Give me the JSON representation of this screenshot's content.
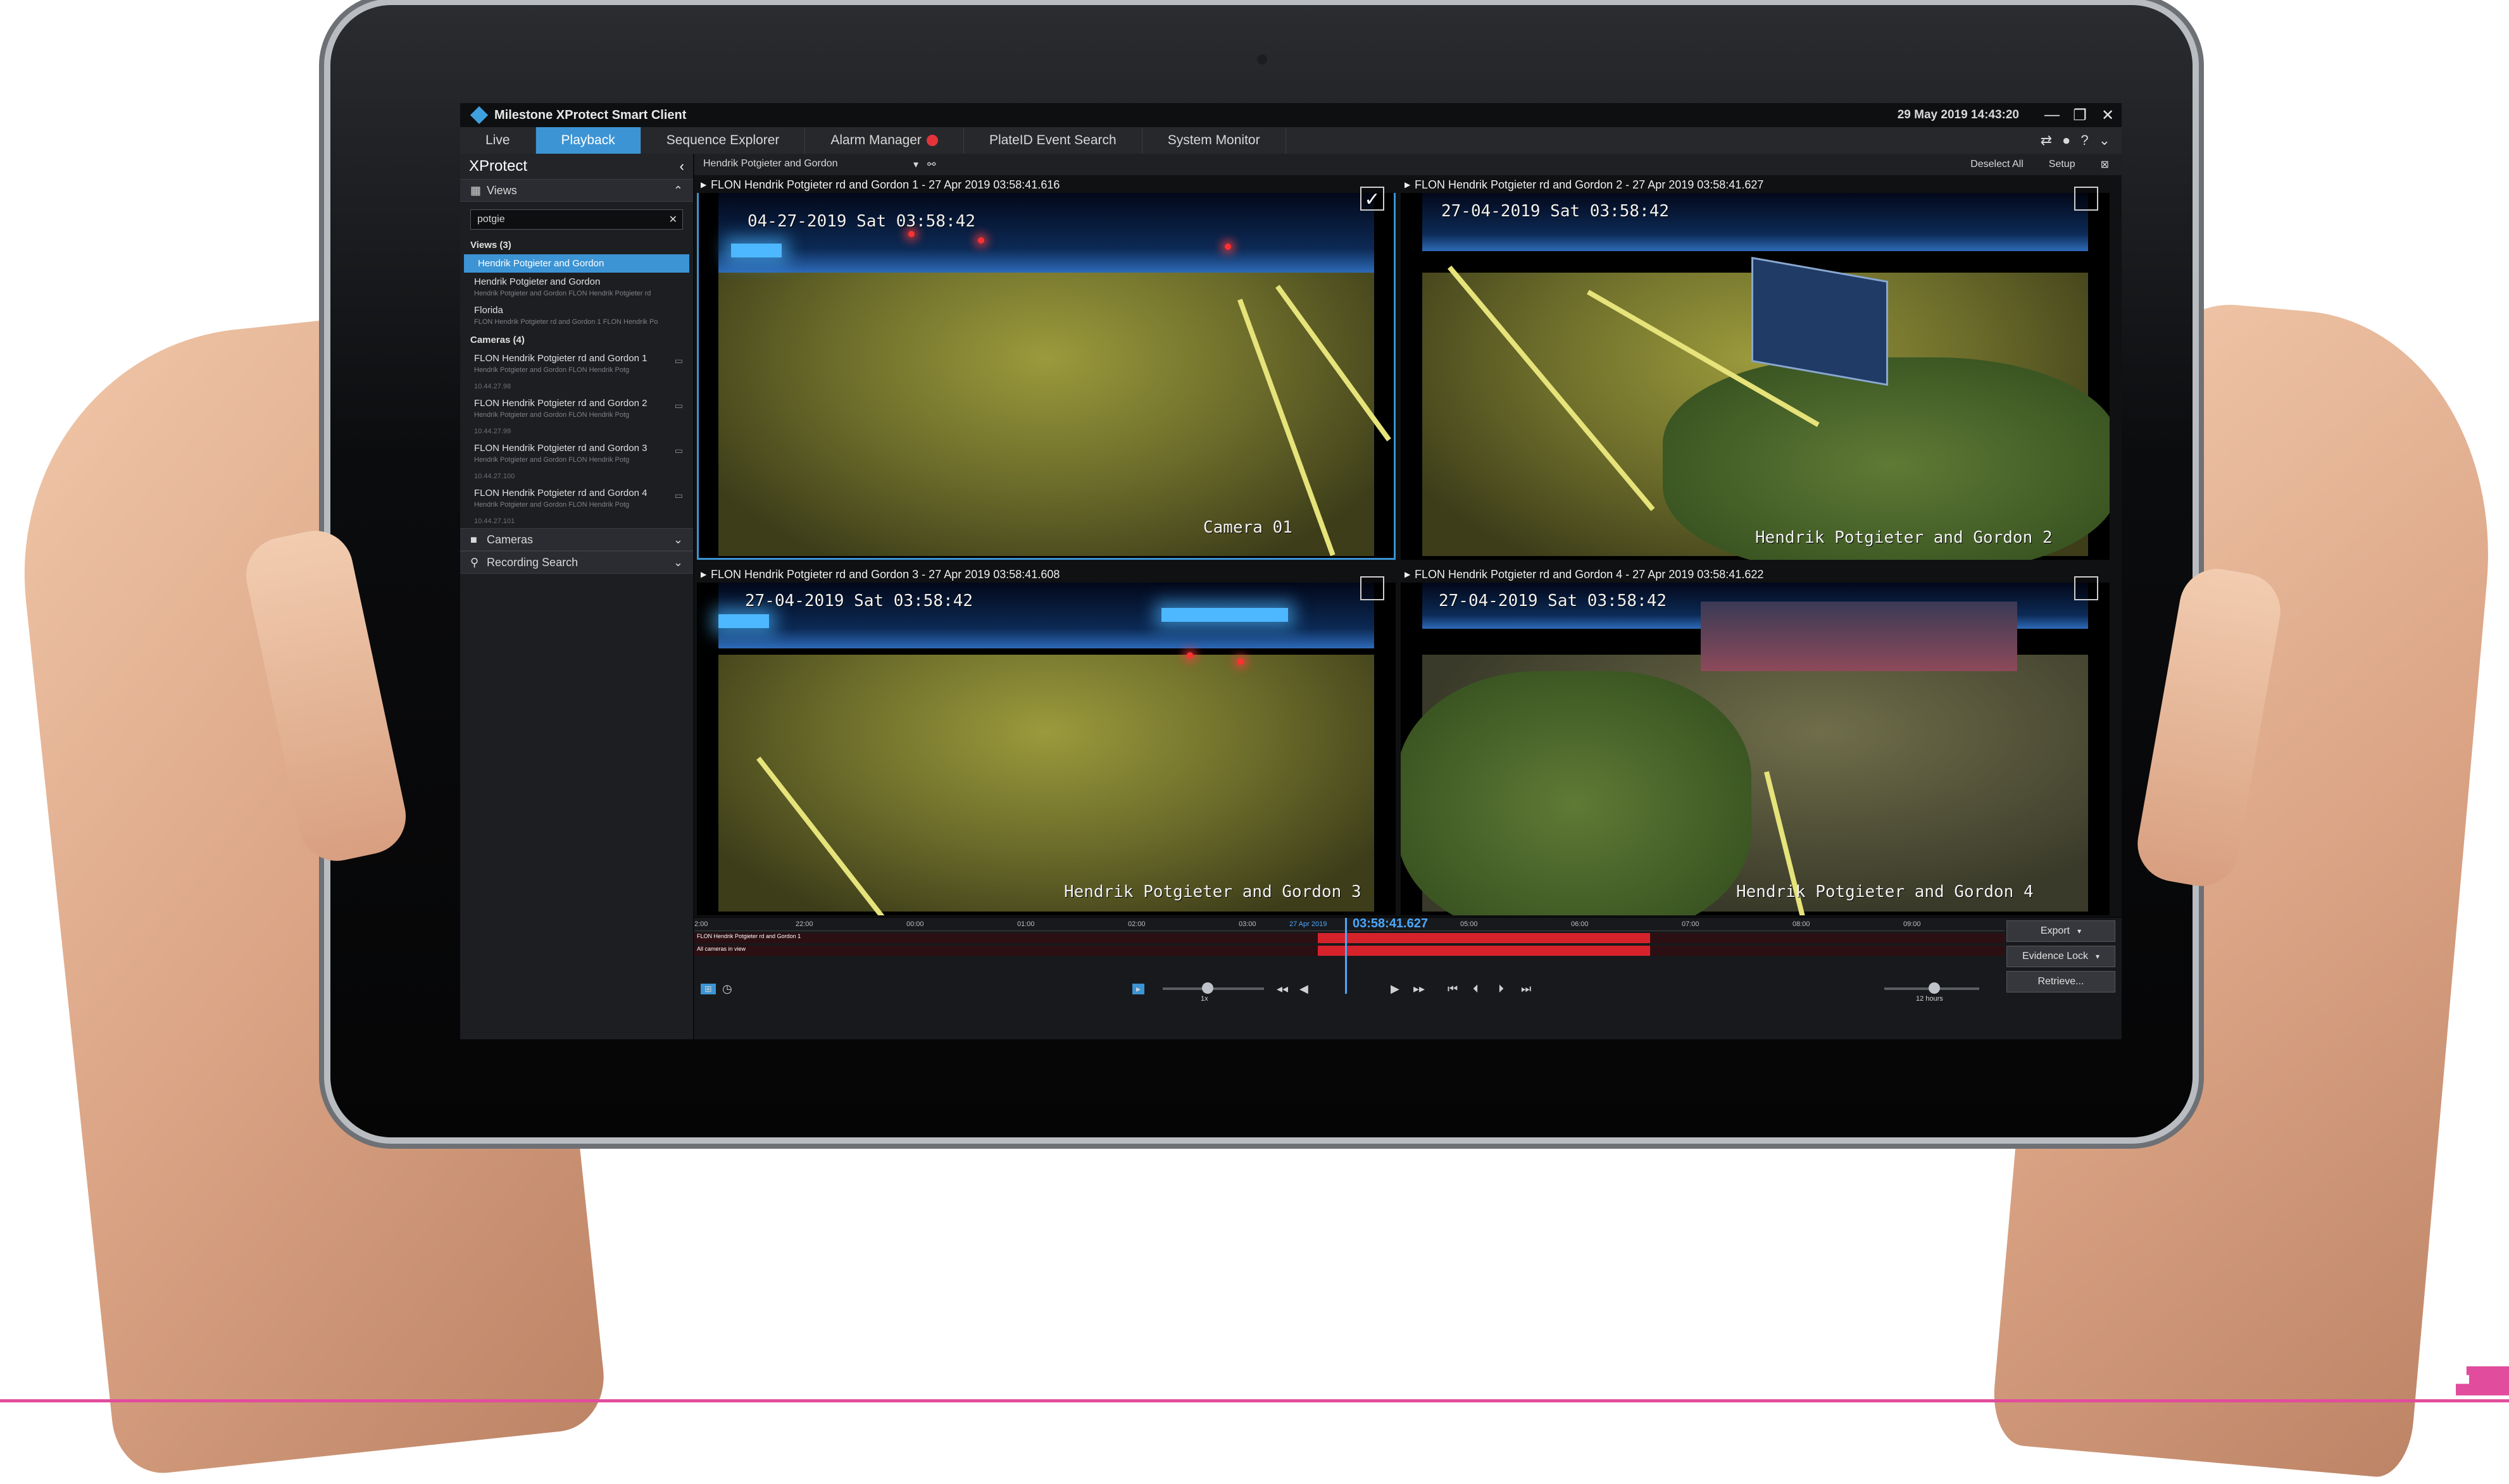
{
  "window": {
    "title": "Milestone XProtect Smart Client",
    "clock": "29 May 2019 14:43:20",
    "minimize": "—",
    "restore": "❐",
    "close": "✕"
  },
  "tabs": [
    {
      "label": "Live"
    },
    {
      "label": "Playback"
    },
    {
      "label": "Sequence Explorer"
    },
    {
      "label": "Alarm Manager"
    },
    {
      "label": "PlateID Event Search"
    },
    {
      "label": "System Monitor"
    }
  ],
  "sidebar": {
    "header": "XProtect",
    "views_pane": "Views",
    "search_value": "potgie",
    "views_section": "Views (3)",
    "views": [
      {
        "label": "Hendrik Potgieter and Gordon",
        "sub": ""
      },
      {
        "label": "Hendrik Potgieter and Gordon",
        "sub": "Hendrik Potgieter and Gordon FLON Hendrik Potgieter rd"
      },
      {
        "label": "Florida",
        "sub": "FLON Hendrik Potgieter rd and Gordon 1 FLON Hendrik Po"
      }
    ],
    "cameras_section": "Cameras (4)",
    "cameras": [
      {
        "label": "FLON Hendrik Potgieter rd and Gordon 1",
        "sub": "Hendrik Potgieter and Gordon FLON Hendrik Potg",
        "ip": "10.44.27.98"
      },
      {
        "label": "FLON Hendrik Potgieter rd and Gordon 2",
        "sub": "Hendrik Potgieter and Gordon FLON Hendrik Potg",
        "ip": "10.44.27.99"
      },
      {
        "label": "FLON Hendrik Potgieter rd and Gordon 3",
        "sub": "Hendrik Potgieter and Gordon FLON Hendrik Potg",
        "ip": "10.44.27.100"
      },
      {
        "label": "FLON Hendrik Potgieter rd and Gordon 4",
        "sub": "Hendrik Potgieter and Gordon FLON Hendrik Potg",
        "ip": "10.44.27.101"
      }
    ],
    "cameras_pane": "Cameras",
    "recording_search_pane": "Recording Search"
  },
  "viewbar": {
    "view_name": "Hendrik Potgieter and Gordon",
    "deselect_all": "Deselect All",
    "setup": "Setup"
  },
  "tiles": [
    {
      "header": "FLON Hendrik Potgieter rd and Gordon 1 - 27 Apr 2019 03:58:41.616",
      "osd_time": "04-27-2019 Sat 03:58:42",
      "osd_name": "Camera 01",
      "checked": "✓"
    },
    {
      "header": "FLON Hendrik Potgieter rd and Gordon 2 - 27 Apr 2019 03:58:41.627",
      "osd_time": "27-04-2019 Sat 03:58:42",
      "osd_name": "Hendrik Potgieter and Gordon 2",
      "checked": ""
    },
    {
      "header": "FLON Hendrik Potgieter rd and Gordon 3 - 27 Apr 2019 03:58:41.608",
      "osd_time": "27-04-2019 Sat 03:58:42",
      "osd_name": "Hendrik Potgieter and Gordon 3",
      "checked": ""
    },
    {
      "header": "FLON Hendrik Potgieter rd and Gordon 4 - 27 Apr 2019 03:58:41.622",
      "osd_time": "27-04-2019 Sat 03:58:42",
      "osd_name": "Hendrik Potgieter and Gordon 4",
      "checked": ""
    }
  ],
  "timeline": {
    "ticks": [
      "2:00",
      "22:00",
      "00:00",
      "01:00",
      "02:00",
      "03:00",
      "05:00",
      "06:00",
      "07:00",
      "08:00",
      "09:00"
    ],
    "date_label": "27 Apr 2019",
    "current_time": "03:58:41.627",
    "track1_label": "FLON Hendrik Potgieter rd and Gordon 1",
    "track2_label": "All cameras in view",
    "speed_label": "1x",
    "range_label": "12 hours",
    "export": "Export",
    "evidence_lock": "Evidence Lock",
    "retrieve": "Retrieve..."
  },
  "colors": {
    "accent": "#3c94d4",
    "recording": "#d6232b",
    "timeline_text": "#4aa8ff"
  }
}
